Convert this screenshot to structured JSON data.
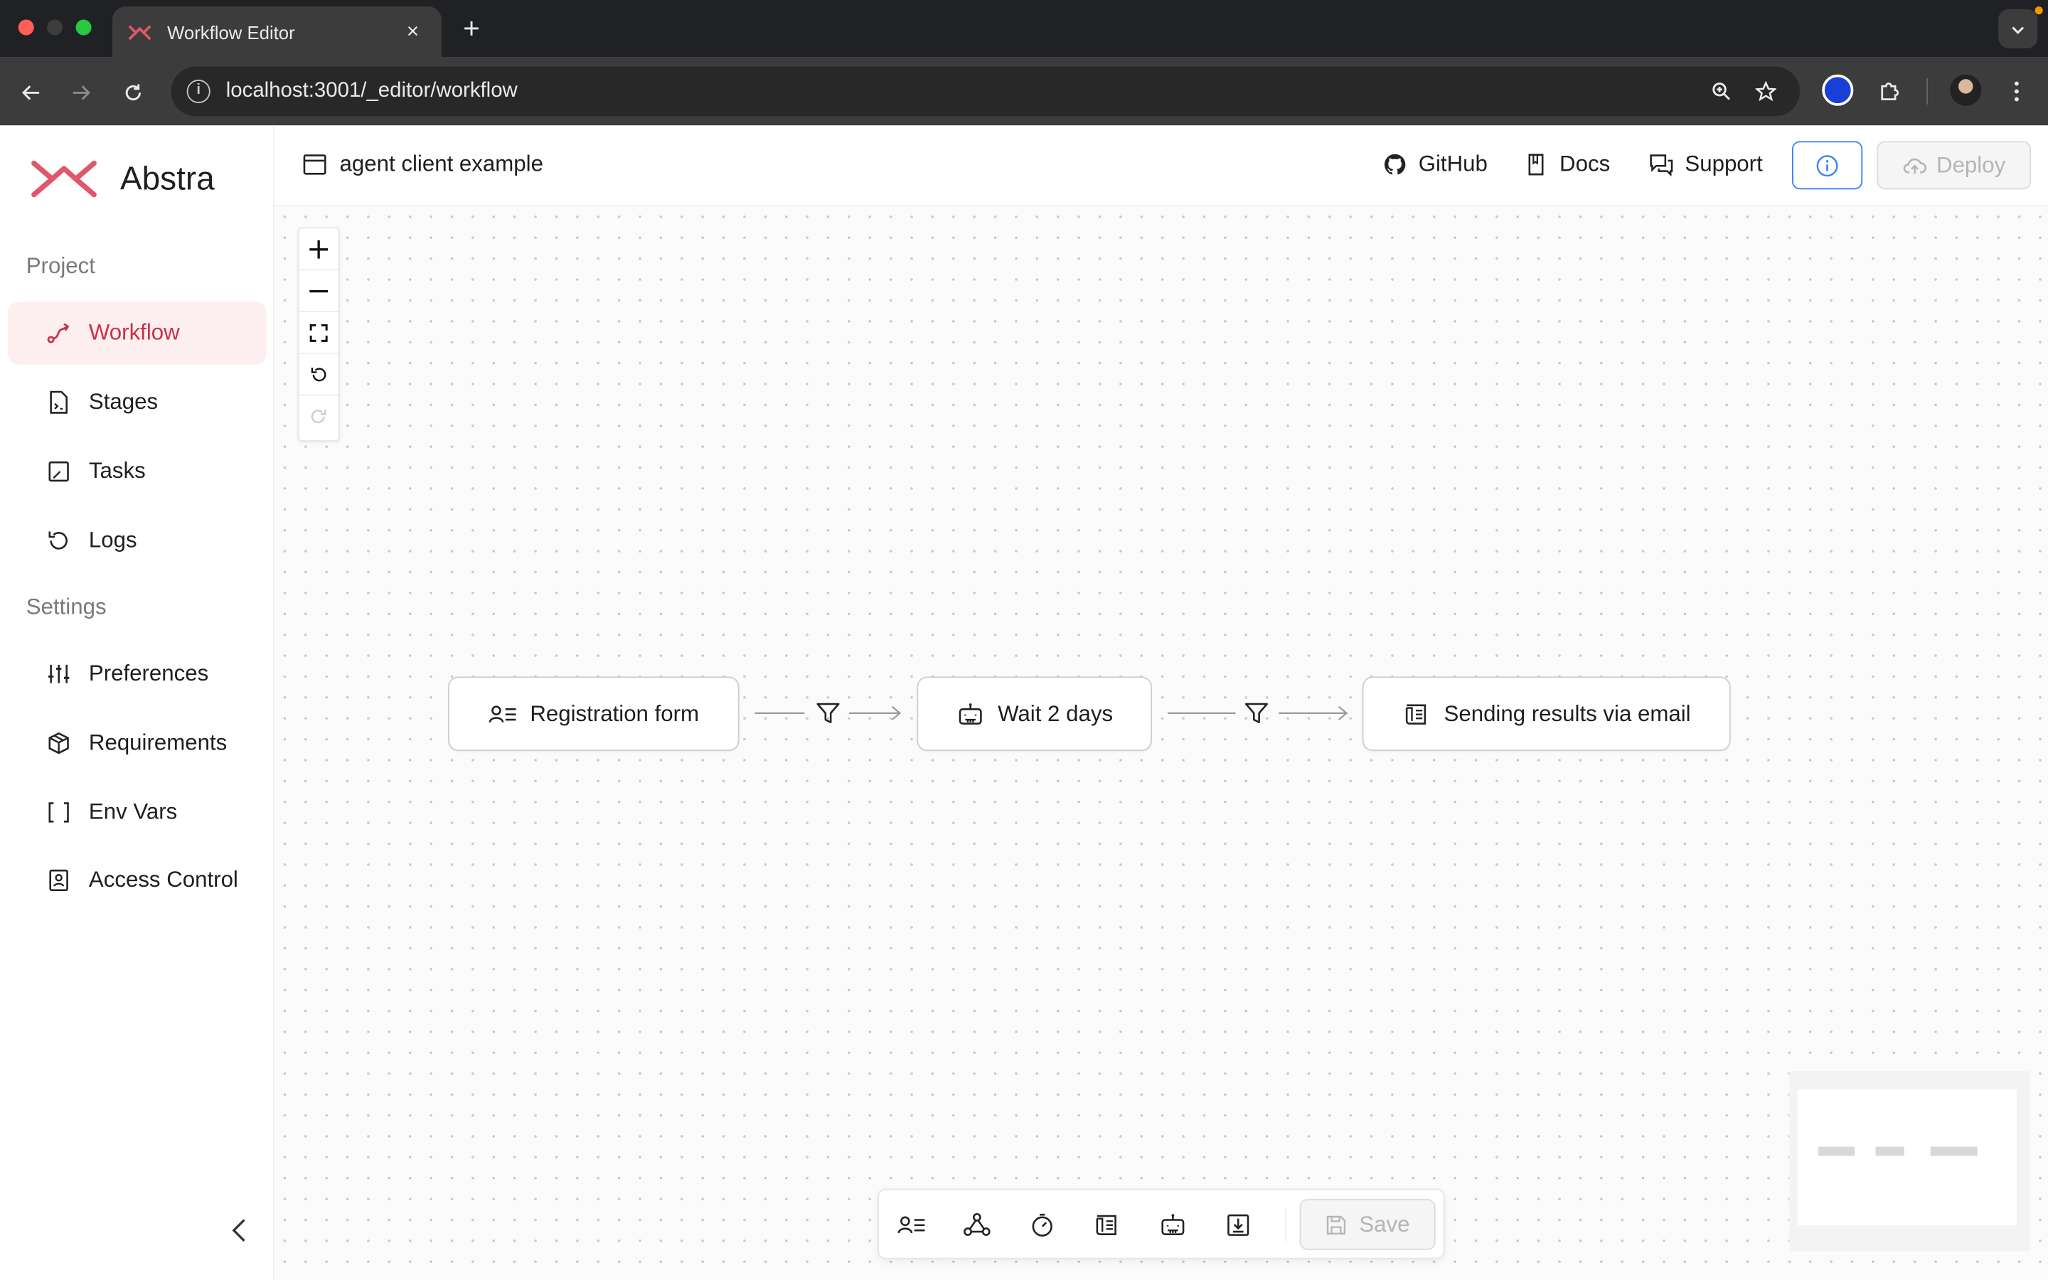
{
  "browser": {
    "tab_title": "Workflow Editor",
    "url": "localhost:3001/_editor/workflow",
    "new_tab": "+",
    "close": "×"
  },
  "brand": {
    "name": "Abstra",
    "accent": "#e0566c"
  },
  "sidebar": {
    "project_label": "Project",
    "settings_label": "Settings",
    "project_items": [
      {
        "label": "Workflow",
        "icon": "workflow-icon",
        "active": true
      },
      {
        "label": "Stages",
        "icon": "stages-icon"
      },
      {
        "label": "Tasks",
        "icon": "tasks-icon"
      },
      {
        "label": "Logs",
        "icon": "logs-icon"
      }
    ],
    "settings_items": [
      {
        "label": "Preferences",
        "icon": "sliders-icon"
      },
      {
        "label": "Requirements",
        "icon": "package-icon"
      },
      {
        "label": "Env Vars",
        "icon": "brackets-icon"
      },
      {
        "label": "Access Control",
        "icon": "id-badge-icon"
      }
    ]
  },
  "topbar": {
    "project_name": "agent client example",
    "links": {
      "github": "GitHub",
      "docs": "Docs",
      "support": "Support"
    },
    "deploy_label": "Deploy"
  },
  "workflow": {
    "nodes": [
      {
        "label": "Registration form",
        "icon": "form-icon"
      },
      {
        "label": "Wait 2 days",
        "icon": "robot-icon"
      },
      {
        "label": "Sending results via email",
        "icon": "script-icon"
      }
    ]
  },
  "bottombar": {
    "tools": [
      "form-icon",
      "hook-icon",
      "timer-icon",
      "script-icon",
      "robot-icon",
      "download-icon"
    ],
    "save_label": "Save"
  }
}
